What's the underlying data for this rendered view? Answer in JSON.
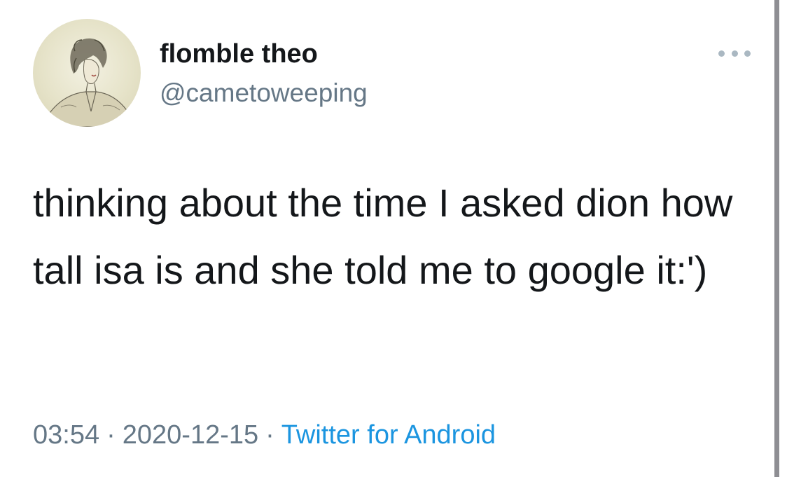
{
  "tweet": {
    "display_name": "flomble theo",
    "handle": "@cametoweeping",
    "text": "thinking about the time I asked dion how tall isa is and she told me to google it:')",
    "time": "03:54",
    "date": "2020-12-15",
    "source": "Twitter for Android",
    "separator": "·"
  },
  "icons": {
    "more": "more-horizontal-icon",
    "avatar": "avatar-sketch"
  },
  "colors": {
    "text": "#14171a",
    "secondary": "#657786",
    "link": "#1b95e0",
    "more_dots": "#aab8c2"
  }
}
